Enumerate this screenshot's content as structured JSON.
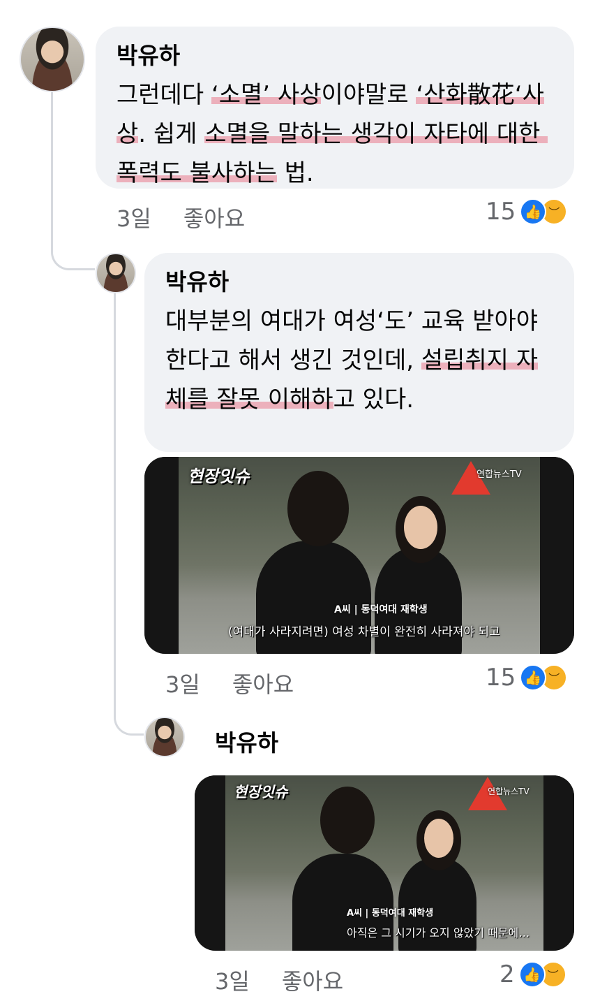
{
  "comments": [
    {
      "author": "박유하",
      "text_plain_1": "그런데다",
      "text_hl_1": "‘소멸’ 사상",
      "text_plain_2": "이야말로",
      "text_hl_2": "‘산화散花‘사상",
      "text_plain_3": ". 쉽게",
      "text_hl_3": "소멸을 말하는 생각이 자타에 대한 폭력도 불사하는",
      "text_plain_4": "법.",
      "time": "3일",
      "like_label": "좋아요",
      "reaction_count": "15"
    },
    {
      "author": "박유하",
      "text_plain_1": "대부분의 여대가 여성‘도’ 교육 받아야 한다고 해서 생긴 것인데,",
      "text_hl_1": "설립취지 자체를 잘못 이해하",
      "text_plain_2": "고 있다.",
      "video": {
        "logo": "현장잇슈",
        "channel": "연합뉴스TV",
        "caption_name": "A씨 | 동덕여대 재학생",
        "caption_text": "(여대가 사라지려면) 여성 차별이 완전히 사라져야 되고"
      },
      "time": "3일",
      "like_label": "좋아요",
      "reaction_count": "15"
    },
    {
      "author": "박유하",
      "video": {
        "logo": "현장잇슈",
        "channel": "연합뉴스TV",
        "caption_name": "A씨 | 동덕여대 재학생",
        "caption_text": "아직은 그 시기가 오지 않았기 때문에…"
      },
      "time": "3일",
      "like_label": "좋아요",
      "reaction_count": "2"
    }
  ],
  "icons": {
    "like": "thumbs-up-icon",
    "sad": "sad-face-icon"
  },
  "colors": {
    "bubble": "#f0f2f5",
    "highlight": "#e87a8c",
    "like": "#1877f2",
    "sad": "#f7b125",
    "meta": "#65676b"
  }
}
